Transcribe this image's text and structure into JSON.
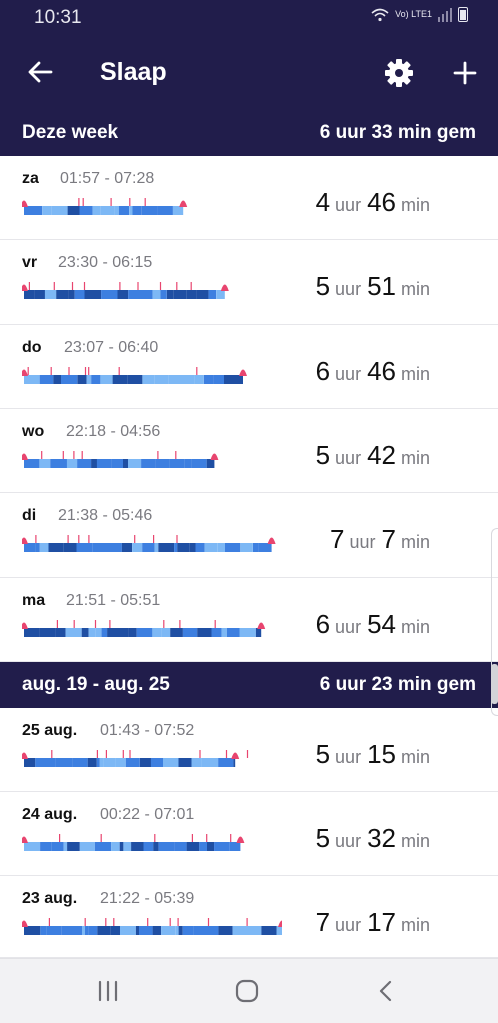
{
  "status_bar": {
    "time": "10:31",
    "network": "Vo) LTE1"
  },
  "app_bar": {
    "title": "Slaap",
    "icons": [
      "back-arrow-icon",
      "gear-icon",
      "plus-icon"
    ]
  },
  "weeks": [
    {
      "label": "Deze week",
      "average": "6 uur 33 min gem",
      "days": [
        {
          "day": "za",
          "range": "01:57 - 07:28",
          "hours": "4",
          "minutes": "46",
          "hour_unit": "uur",
          "min_unit": "min"
        },
        {
          "day": "vr",
          "range": "23:30 - 06:15",
          "hours": "5",
          "minutes": "51",
          "hour_unit": "uur",
          "min_unit": "min"
        },
        {
          "day": "do",
          "range": "23:07 - 06:40",
          "hours": "6",
          "minutes": "46",
          "hour_unit": "uur",
          "min_unit": "min"
        },
        {
          "day": "wo",
          "range": "22:18 - 04:56",
          "hours": "5",
          "minutes": "42",
          "hour_unit": "uur",
          "min_unit": "min"
        },
        {
          "day": "di",
          "range": "21:38 - 05:46",
          "hours": "7",
          "minutes": "7",
          "hour_unit": "uur",
          "min_unit": "min"
        },
        {
          "day": "ma",
          "range": "21:51 - 05:51",
          "hours": "6",
          "minutes": "54",
          "hour_unit": "uur",
          "min_unit": "min"
        }
      ]
    },
    {
      "label": "aug. 19 - aug. 25",
      "average": "6 uur 23 min gem",
      "days": [
        {
          "day": "25 aug.",
          "range": "01:43 - 07:52",
          "hours": "5",
          "minutes": "15",
          "hour_unit": "uur",
          "min_unit": "min"
        },
        {
          "day": "24 aug.",
          "range": "00:22 - 07:01",
          "hours": "5",
          "minutes": "32",
          "hour_unit": "uur",
          "min_unit": "min"
        },
        {
          "day": "23 aug.",
          "range": "21:22 - 05:39",
          "hours": "7",
          "minutes": "17",
          "hour_unit": "uur",
          "min_unit": "min"
        }
      ]
    }
  ],
  "colors": {
    "header_bg": "#211d4b",
    "deep": "#1f4fa3",
    "light": "#3d7fe0",
    "rem": "#7db8f5",
    "awake": "#e8456f"
  },
  "nav_bar": {
    "icons": [
      "recent-apps-icon",
      "home-icon",
      "back-nav-icon"
    ]
  }
}
